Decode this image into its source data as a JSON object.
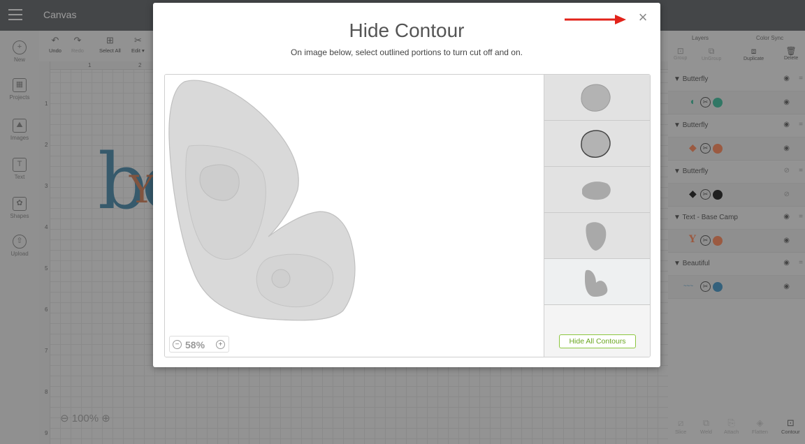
{
  "app": {
    "title": "Canvas"
  },
  "left_rail": [
    {
      "label": "New",
      "glyph": "+"
    },
    {
      "label": "Projects",
      "glyph": "▦"
    },
    {
      "label": "Images",
      "glyph": "⛰"
    },
    {
      "label": "Text",
      "glyph": "T"
    },
    {
      "label": "Shapes",
      "glyph": "✿"
    },
    {
      "label": "Upload",
      "glyph": "⇧"
    }
  ],
  "toolbar": {
    "undo": "Undo",
    "redo": "Redo",
    "select_all": "Select All",
    "edit": "Edit ▾"
  },
  "ruler": {
    "h": [
      "1",
      "2"
    ],
    "v": [
      "1",
      "2",
      "3",
      "4",
      "5",
      "6",
      "7",
      "8",
      "9"
    ]
  },
  "canvas_zoom": "100%",
  "right_panel": {
    "tabs": [
      "Layers",
      "Color Sync"
    ],
    "tools": [
      "Group",
      "UnGroup",
      "Duplicate",
      "Delete"
    ],
    "layers": [
      {
        "name": "Butterfly",
        "color": "#1f9e7e"
      },
      {
        "name": "Butterfly",
        "color": "#e06a3c"
      },
      {
        "name": "Butterfly",
        "color": "#000000"
      },
      {
        "name": "Text - Base Camp",
        "color": "#e06a3c"
      },
      {
        "name": "Beautiful",
        "color": "#2677a8"
      }
    ],
    "bottom_tools": [
      "Slice",
      "Weld",
      "Attach",
      "Flatten",
      "Contour"
    ]
  },
  "modal": {
    "title": "Hide Contour",
    "subtitle": "On image below, select outlined portions to turn cut off and on.",
    "close_glyph": "×",
    "zoom": "58%",
    "hide_all_label": "Hide All Contours",
    "accent": "#8cc63f",
    "arrow_color": "#e2231a"
  }
}
